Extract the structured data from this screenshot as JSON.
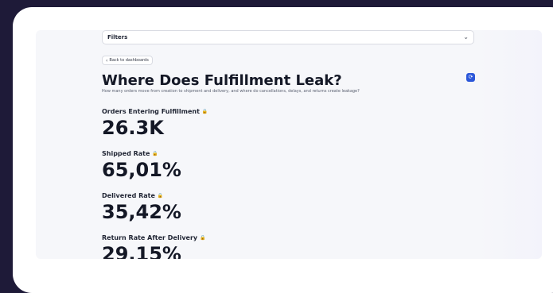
{
  "filters": {
    "label": "Filters",
    "chevron": "chevron-down-icon"
  },
  "back": {
    "label": "Back to dashboards",
    "icon": "chevron-left-icon"
  },
  "page": {
    "title": "Where Does Fulfillment Leak?",
    "subtitle": "How many orders move from creation to shipment and delivery, and where do cancellations, delays, and returns create leakage?",
    "refresh_icon": "refresh-icon"
  },
  "metrics": [
    {
      "label": "Orders Entering Fulfillment",
      "value": "26.3K"
    },
    {
      "label": "Shipped Rate",
      "value": "65,01%"
    },
    {
      "label": "Delivered Rate",
      "value": "35,42%"
    },
    {
      "label": "Return Rate After Delivery",
      "value": "29,15%"
    }
  ],
  "colors": {
    "background": "#1e1a38",
    "accent": "#2b57d9",
    "badge": "#1aa36a"
  }
}
